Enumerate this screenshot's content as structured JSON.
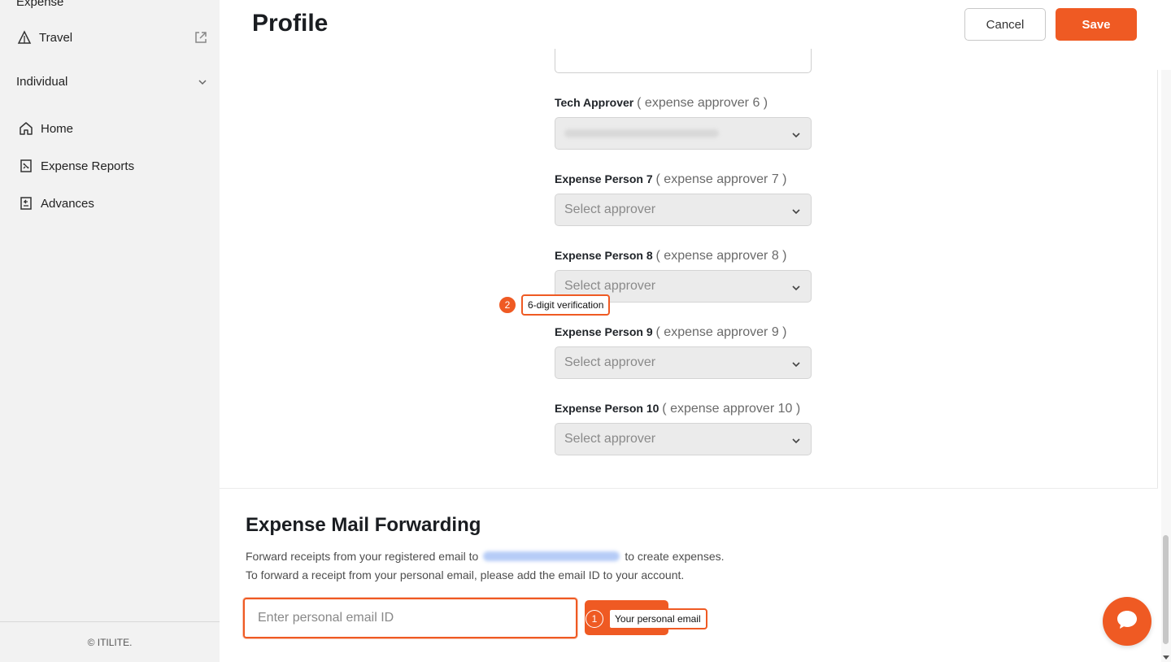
{
  "sidebar": {
    "section_title": "Expense",
    "travel_label": "Travel",
    "individual_label": "Individual",
    "items": [
      {
        "label": "Home",
        "icon": "home-icon"
      },
      {
        "label": "Expense Reports",
        "icon": "receipt-icon"
      },
      {
        "label": "Advances",
        "icon": "advances-icon"
      }
    ],
    "footer": "© ITILITE."
  },
  "header": {
    "title": "Profile",
    "cancel_label": "Cancel",
    "save_label": "Save"
  },
  "approvers": [
    {
      "name": "Tech Approver",
      "sub": "( expense approver 6 )",
      "value": "",
      "blurred": true
    },
    {
      "name": "Expense Person 7",
      "sub": "( expense approver 7 )",
      "value": "Select approver"
    },
    {
      "name": "Expense Person 8",
      "sub": "( expense approver 8 )",
      "value": "Select approver"
    },
    {
      "name": "Expense Person 9",
      "sub": "( expense approver 9 )",
      "value": "Select approver"
    },
    {
      "name": "Expense Person 10",
      "sub": "( expense approver 10 )",
      "value": "Select approver"
    }
  ],
  "mail_forwarding": {
    "title": "Expense Mail Forwarding",
    "line1_prefix": "Forward receipts from your registered email to",
    "line1_suffix": "to create expenses.",
    "line2": "To forward a receipt from your personal email, please add the email ID to your account.",
    "email_placeholder": "Enter personal email ID"
  },
  "annotations": [
    {
      "number": "1",
      "label": "Your personal email"
    },
    {
      "number": "2",
      "label": "6-digit verification"
    }
  ],
  "colors": {
    "accent": "#ef5a23",
    "sidebar_bg": "#f2f2f2",
    "select_bg": "#ebebeb"
  }
}
